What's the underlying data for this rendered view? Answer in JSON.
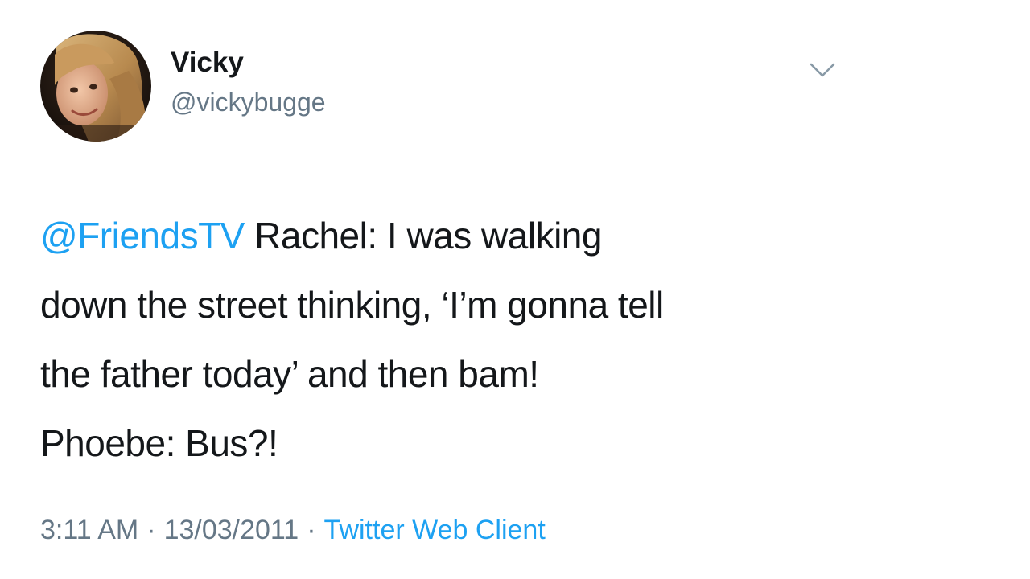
{
  "tweet": {
    "author": {
      "display_name": "Vicky",
      "handle": "@vickybugge",
      "avatar_icon": "profile-photo"
    },
    "menu_icon": "chevron-down-icon",
    "mention": "@FriendsTV",
    "text_lines": [
      " Rachel:  I was walking",
      "down the street thinking, ‘I’m gonna tell",
      "the father today’ and then bam!",
      "Phoebe: Bus?!"
    ],
    "meta": {
      "time": "3:11 AM",
      "separator": "·",
      "date": "13/03/2011",
      "source": "Twitter Web Client"
    }
  },
  "colors": {
    "text": "#14171a",
    "secondary": "#657786",
    "link": "#1da1f2",
    "background": "#ffffff"
  }
}
